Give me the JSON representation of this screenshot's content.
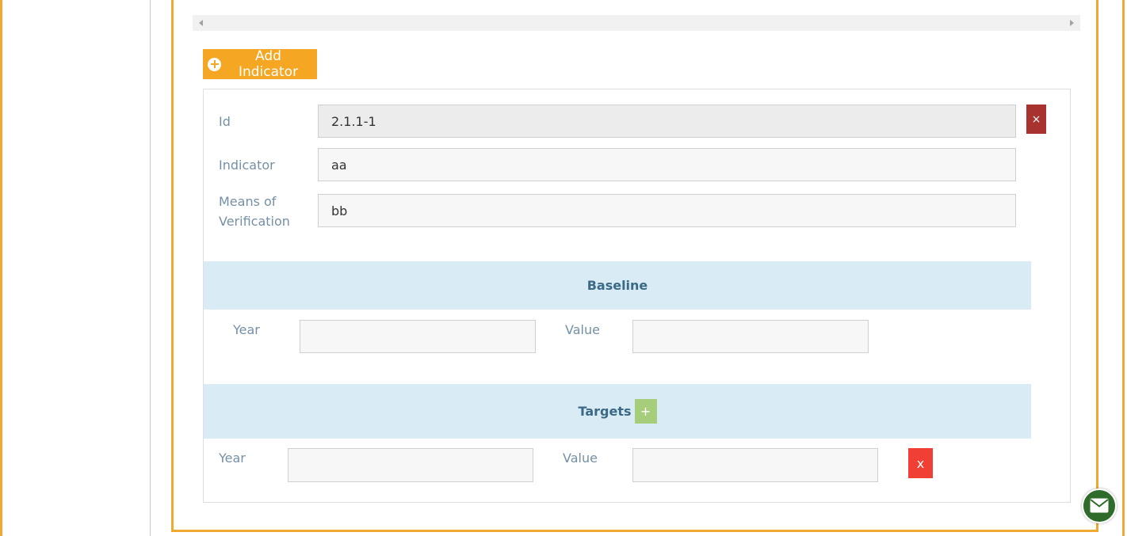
{
  "toolbar": {
    "add_indicator_label": "Add Indicator"
  },
  "indicator": {
    "id_label": "Id",
    "id_value": "2.1.1-1",
    "indicator_label": "Indicator",
    "indicator_value": "aa",
    "means_label_line1": "Means of",
    "means_label_line2": "Verification",
    "means_value": "bb",
    "remove_label": "×"
  },
  "baseline": {
    "title": "Baseline",
    "year_label": "Year",
    "year_value": "",
    "value_label": "Value",
    "value_value": ""
  },
  "targets": {
    "title": "Targets",
    "add_label": "+",
    "year_label": "Year",
    "year_value": "",
    "value_label": "Value",
    "value_value": "",
    "remove_label": "x"
  },
  "colors": {
    "accent": "#f5a623",
    "band": "#d9ebf4",
    "danger": "#a8322d",
    "remove": "#f04035",
    "add_green": "#a6cd7a",
    "mail": "#2f6b2a"
  },
  "icons": {
    "add": "plus-circle-icon",
    "scroll_left": "arrow-left-icon",
    "scroll_right": "arrow-right-icon",
    "mail": "envelope-icon"
  }
}
